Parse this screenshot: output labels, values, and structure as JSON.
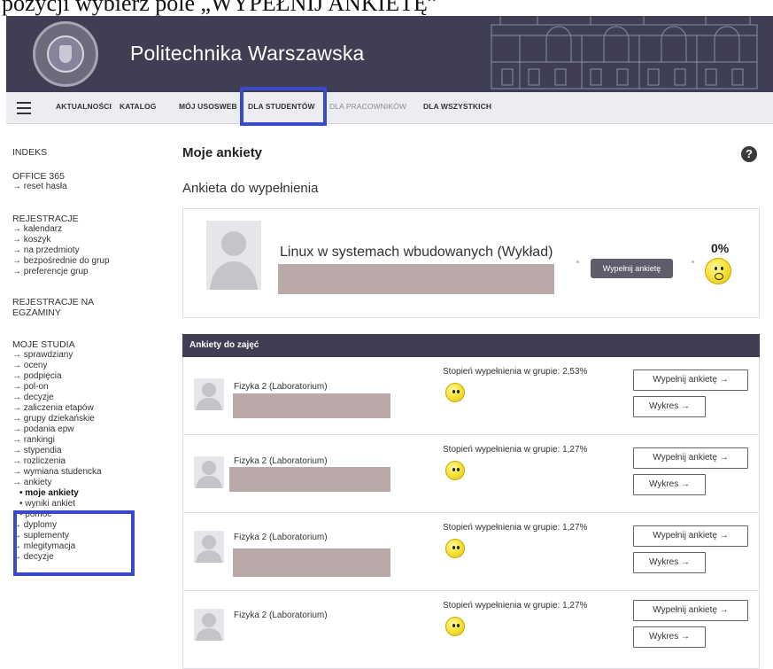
{
  "caption": "pozycji wybierz pole „WYPEŁNIJ ANKIETĘ”",
  "header": {
    "title": "Politechnika Warszawska"
  },
  "nav": {
    "items": [
      {
        "label": "AKTUALNOŚCI"
      },
      {
        "label": "KATALOG"
      },
      {
        "label": "MÓJ USOSWEB"
      },
      {
        "label": "DLA STUDENTÓW"
      },
      {
        "label": "DLA PRACOWNIKÓW"
      },
      {
        "label": "DLA WSZYSTKICH"
      }
    ]
  },
  "sidebar": {
    "indeks": "INDEKS",
    "office": "OFFICE 365",
    "office_items": [
      "→ reset hasła"
    ],
    "rejestracje": "REJESTRACJE",
    "rejestracje_items": [
      "→ kalendarz",
      "→ koszyk",
      "→ na przedmioty",
      "→ bezpośrednie do grup",
      "→ preferencje grup"
    ],
    "rej_egz_1": "REJESTRACJE NA",
    "rej_egz_2": "EGZAMINY",
    "moje_studia": "MOJE STUDIA",
    "moje_studia_items": [
      "→ sprawdziany",
      "→ oceny",
      "→ podpięcia",
      "→ pol-on",
      "→ decyzje",
      "→ zaliczenia etapów",
      "→ grupy dziekańskie",
      "→ podania epw",
      "→ rankingi",
      "→ stypendia",
      "→ rozliczenia",
      "→ wymiana studencka",
      "→ ankiety"
    ],
    "ankiety_sub": [
      "• moje ankiety",
      "• wyniki ankiet",
      "• pomoc"
    ],
    "after_items": [
      "→ dyplomy",
      "→ suplementy",
      "→ mlegitymacja",
      "→ decyzje"
    ]
  },
  "main": {
    "page_title": "Moje ankiety",
    "help": "?",
    "subtitle": "Ankieta do wypełnienia",
    "featured": {
      "course": "Linux w systemach wbudowanych (Wykład)",
      "button": "Wypełnij ankietę",
      "percent": "0%"
    },
    "panel_title": "Ankiety do zajęć",
    "rows": [
      {
        "course": "Fizyka 2 (Laboratorium)",
        "degree": "Stopień wypełnienia w grupie: 2,53%",
        "fill": "Wypełnij ankietę →",
        "chart": "Wykres →"
      },
      {
        "course": "Fizyka 2 (Laboratorium)",
        "degree": "Stopień wypełnienia w grupie: 1,27%",
        "fill": "Wypełnij ankietę →",
        "chart": "Wykres →"
      },
      {
        "course": "Fizyka 2 (Laboratorium)",
        "degree": "Stopień wypełnienia w grupie: 1,27%",
        "fill": "Wypełnij ankietę →",
        "chart": "Wykres →"
      },
      {
        "course": "Fizyka 2 (Laboratorium)",
        "degree": "Stopień wypełnienia w grupie: 1,27%",
        "fill": "Wypełnij ankietę →",
        "chart": "Wykres →"
      }
    ]
  },
  "colors": {
    "header_bg": "#3f3e52",
    "highlight": "#3a49c9",
    "nav_bg": "#ececf1"
  }
}
